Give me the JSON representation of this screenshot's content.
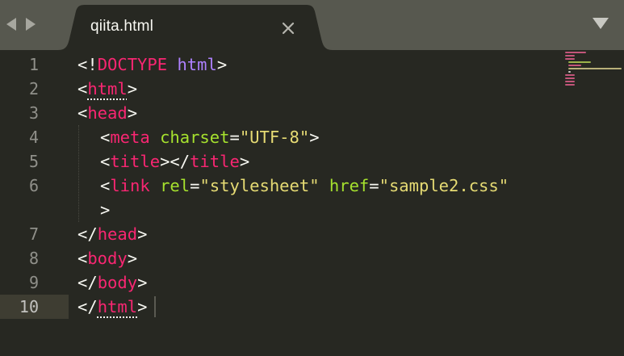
{
  "tabbar": {
    "tab_title": "qiita.html"
  },
  "icons": {
    "back": "chevron-left-icon",
    "forward": "chevron-right-icon",
    "close": "close-icon",
    "dropdown": "triangle-down-icon"
  },
  "colors": {
    "background": "#272822",
    "tabbar": "#57584f",
    "tag": "#f92672",
    "attribute": "#a6e22e",
    "string": "#e6db74",
    "keyword": "#ae81ff",
    "text": "#f8f8f2",
    "line_number": "#90908a"
  },
  "editor": {
    "line_numbers": [
      "1",
      "2",
      "3",
      "4",
      "5",
      "6",
      "",
      "7",
      "8",
      "9",
      "10"
    ],
    "current_line": "10",
    "lines": {
      "l1": {
        "a": "<!",
        "b": "DOCTYPE",
        "c": " ",
        "d": "html",
        "e": ">"
      },
      "l2": {
        "a": "<",
        "b": "html",
        "c": ">"
      },
      "l3": {
        "a": "<",
        "b": "head",
        "c": ">"
      },
      "l4": {
        "a": "<",
        "b": "meta",
        "c": " ",
        "d": "charset",
        "e": "=",
        "f": "\"UTF-8\"",
        "g": ">"
      },
      "l5": {
        "a": "<",
        "b": "title",
        "c": "></",
        "d": "title",
        "e": ">"
      },
      "l6": {
        "a": "<",
        "b": "link",
        "c": " ",
        "d": "rel",
        "e": "=",
        "f": "\"stylesheet\"",
        "g": " ",
        "h": "href",
        "i": "=",
        "j": "\"sample2.css\""
      },
      "l6b": {
        "a": ">"
      },
      "l7": {
        "a": "</",
        "b": "head",
        "c": ">"
      },
      "l8": {
        "a": "<",
        "b": "body",
        "c": ">"
      },
      "l9": {
        "a": "</",
        "b": "body",
        "c": ">"
      },
      "l10": {
        "a": "</",
        "b": "html",
        "c": ">"
      }
    }
  }
}
